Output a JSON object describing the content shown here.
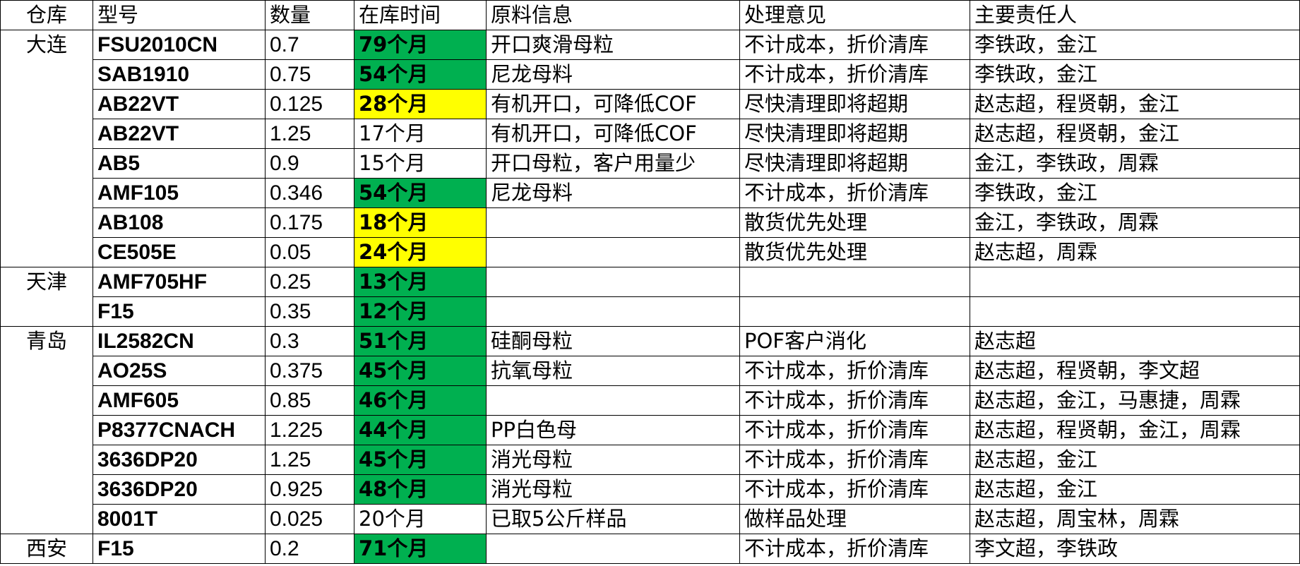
{
  "headers": {
    "warehouse": "仓库",
    "model": "型号",
    "qty": "数量",
    "age": "在库时间",
    "material": "原料信息",
    "action": "处理意见",
    "owner": "主要责任人"
  },
  "warehouses": [
    {
      "name": "大连",
      "rows": [
        {
          "model": "FSU2010CN",
          "qty": "0.7",
          "age": "79个月",
          "fill": "#00b050",
          "material": "开口爽滑母粒",
          "action": "不计成本，折价清库",
          "owner": "李铁政，金江"
        },
        {
          "model": "SAB1910",
          "qty": "0.75",
          "age": "54个月",
          "fill": "#00b050",
          "material": "尼龙母料",
          "action": "不计成本，折价清库",
          "owner": "李铁政，金江"
        },
        {
          "model": "AB22VT",
          "qty": "0.125",
          "age": "28个月",
          "fill": "#ffff00",
          "material": "有机开口，可降低COF",
          "action": "尽快清理即将超期",
          "owner": "赵志超，程贤朝，金江"
        },
        {
          "model": "AB22VT",
          "qty": "1.25",
          "age": "17个月",
          "material": "有机开口，可降低COF",
          "action": "尽快清理即将超期",
          "owner": "赵志超，程贤朝，金江"
        },
        {
          "model": "AB5",
          "qty": "0.9",
          "age": "15个月",
          "material": "开口母粒，客户用量少",
          "action": "尽快清理即将超期",
          "owner": "金江，李铁政，周霖"
        },
        {
          "model": "AMF105",
          "qty": "0.346",
          "age": "54个月",
          "fill": "#00b050",
          "material": "尼龙母料",
          "action": "不计成本，折价清库",
          "owner": "李铁政，金江"
        },
        {
          "model": "AB108",
          "qty": "0.175",
          "age": "18个月",
          "fill": "#ffff00",
          "action": "散货优先处理",
          "owner": "金江，李铁政，周霖"
        },
        {
          "model": "CE505E",
          "qty": "0.05",
          "age": "24个月",
          "fill": "#ffff00",
          "action": "散货优先处理",
          "owner": "赵志超，周霖"
        }
      ]
    },
    {
      "name": "天津",
      "rows": [
        {
          "model": "AMF705HF",
          "qty": "0.25",
          "age": "13个月",
          "fill": "#00b050"
        },
        {
          "model": "F15",
          "qty": "0.35",
          "age": "12个月",
          "fill": "#00b050"
        }
      ]
    },
    {
      "name": "青岛",
      "rows": [
        {
          "model": "IL2582CN",
          "qty": "0.3",
          "age": "51个月",
          "fill": "#00b050",
          "material": "硅酮母粒",
          "action": "POF客户消化",
          "owner": "赵志超"
        },
        {
          "model": "AO25S",
          "qty": "0.375",
          "age": "45个月",
          "fill": "#00b050",
          "material": "抗氧母粒",
          "action": "不计成本，折价清库",
          "owner": "赵志超，程贤朝，李文超"
        },
        {
          "model": "AMF605",
          "qty": "0.85",
          "age": "46个月",
          "fill": "#00b050",
          "action": "不计成本，折价清库",
          "owner": "赵志超，金江，马惠捷，周霖"
        },
        {
          "model": "P8377CNACH",
          "qty": "1.225",
          "age": "44个月",
          "fill": "#00b050",
          "material": "PP白色母",
          "action": "不计成本，折价清库",
          "owner": "赵志超，程贤朝，金江，周霖"
        },
        {
          "model": "3636DP20",
          "qty": "1.25",
          "age": "45个月",
          "fill": "#00b050",
          "material": "消光母粒",
          "action": "不计成本，折价清库",
          "owner": "赵志超，金江"
        },
        {
          "model": "3636DP20",
          "qty": "0.925",
          "age": "48个月",
          "fill": "#00b050",
          "material": "消光母粒",
          "action": "不计成本，折价清库",
          "owner": "赵志超，金江"
        },
        {
          "model": "8001T",
          "qty": "0.025",
          "age": "20个月",
          "material": "已取5公斤样品",
          "action": "做样品处理",
          "owner": "赵志超，周宝林，周霖"
        }
      ]
    },
    {
      "name": "西安",
      "rows": [
        {
          "model": "F15",
          "qty": "0.2",
          "age": "71个月",
          "fill": "#00b050",
          "action": "不计成本，折价清库",
          "owner": "李文超，李铁政"
        }
      ]
    }
  ]
}
